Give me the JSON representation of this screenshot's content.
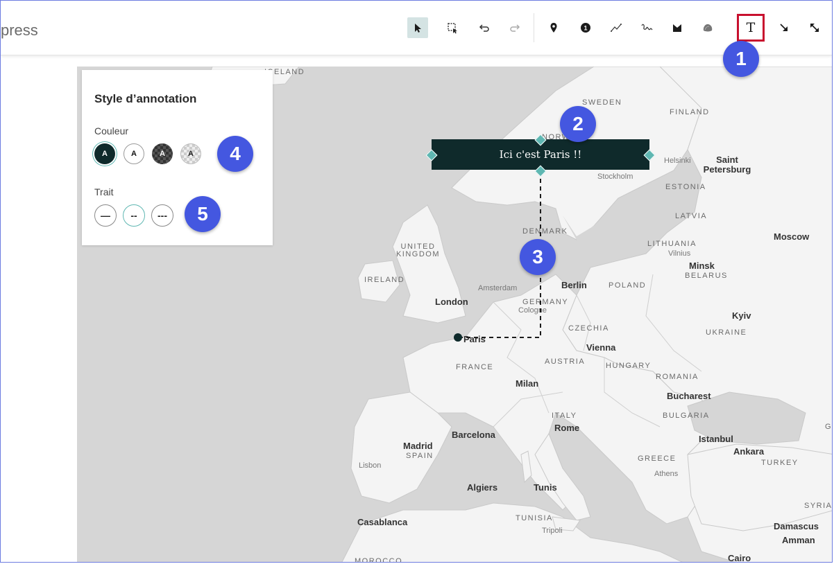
{
  "app": {
    "title_partial": "press"
  },
  "toolbar": {
    "tools": [
      {
        "name": "select",
        "icon": "pointer-arrow-icon",
        "active": true
      },
      {
        "name": "box-select",
        "icon": "box-select-icon"
      },
      {
        "name": "undo",
        "icon": "undo-icon"
      },
      {
        "name": "redo",
        "icon": "redo-icon"
      },
      {
        "name": "pin",
        "icon": "map-pin-icon"
      },
      {
        "name": "numbered-marker",
        "icon": "numbered-marker-icon",
        "glyph": "1"
      },
      {
        "name": "line",
        "icon": "polyline-icon"
      },
      {
        "name": "freehand",
        "icon": "freehand-icon"
      },
      {
        "name": "polygon",
        "icon": "polygon-icon"
      },
      {
        "name": "freehand-area",
        "icon": "freehand-area-icon"
      },
      {
        "name": "text",
        "icon": "text-tool-icon",
        "glyph": "T",
        "highlighted": true
      },
      {
        "name": "arrow",
        "icon": "arrow-down-right-icon"
      },
      {
        "name": "double-arrow",
        "icon": "double-arrow-icon"
      }
    ],
    "highlight_color": "#c8102e"
  },
  "panel": {
    "title": "Style d’annotation",
    "color_label": "Couleur",
    "stroke_label": "Trait",
    "color_options": [
      {
        "glyph": "A",
        "style": "dark",
        "selected": true
      },
      {
        "glyph": "A",
        "style": "light"
      },
      {
        "glyph": "A",
        "style": "dark-transparent"
      },
      {
        "glyph": "A",
        "style": "light-transparent"
      }
    ],
    "stroke_options": [
      {
        "glyph": "—",
        "style": "solid"
      },
      {
        "glyph": "--",
        "style": "dashed",
        "selected": true
      },
      {
        "glyph": "---",
        "style": "dotted"
      }
    ]
  },
  "annotation": {
    "text": "Ici c'est Paris !!",
    "color": "#0f2a2b",
    "handle_color": "#5fb7b2"
  },
  "badges": [
    "1",
    "2",
    "3",
    "4",
    "5"
  ],
  "badge_color": "#4457e0",
  "map": {
    "countries": [
      "ICELAND",
      "SWEDEN",
      "FINLAND",
      "NORWAY",
      "ESTONIA",
      "LATVIA",
      "DENMARK",
      "LITHUANIA",
      "UNITED KINGDOM",
      "IRELAND",
      "BELARUS",
      "POLAND",
      "GERMANY",
      "CZECHIA",
      "UKRAINE",
      "AUSTRIA",
      "HUNGARY",
      "FRANCE",
      "ROMANIA",
      "BULGARIA",
      "ITALY",
      "SPAIN",
      "GREECE",
      "TURKEY",
      "TUNISIA",
      "MOROCCO",
      "SYRIA"
    ],
    "cities_major": [
      "Saint Petersburg",
      "Moscow",
      "Minsk",
      "Berlin",
      "London",
      "Kyiv",
      "Vienna",
      "Milan",
      "Bucharest",
      "Rome",
      "Istanbul",
      "Ankara",
      "Madrid",
      "Barcelona",
      "Algiers",
      "Tunis",
      "Casablanca",
      "Damascus",
      "Amman",
      "Cairo"
    ],
    "cities_minor": [
      "Helsinki",
      "Stockholm",
      "Vilnius",
      "Amsterdam",
      "Cologne",
      "Lisbon",
      "Athens",
      "Tripoli"
    ],
    "marker_city": "Paris",
    "edge_label": "GE",
    "land_color": "#f4f4f4",
    "sea_color": "#d6d6d6"
  }
}
